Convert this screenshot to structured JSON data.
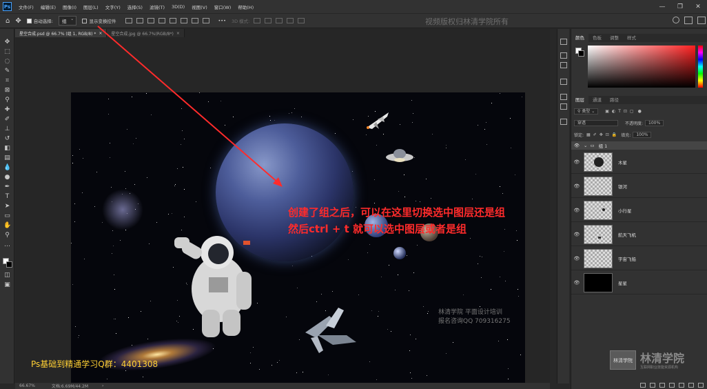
{
  "menubar": {
    "logo": "Ps",
    "items": [
      "文件(F)",
      "编辑(E)",
      "图像(I)",
      "图层(L)",
      "文字(Y)",
      "选择(S)",
      "滤镜(T)",
      "3D(D)",
      "视图(V)",
      "窗口(W)",
      "帮助(H)"
    ],
    "win_controls": [
      "—",
      "❐",
      "✕"
    ]
  },
  "options": {
    "auto_select_label": "自动选择:",
    "auto_select_value": "组",
    "show_transform_label": "显示变换控件",
    "mode_3d_label": "3D 模式:",
    "watermark": "视频版权归林清学院所有"
  },
  "tabs": [
    {
      "label": "星空合成.psd @ 66.7% (组 1, RGB/8) *"
    },
    {
      "label": "星空合成.jpg @ 66.7%(RGB/8*)"
    }
  ],
  "canvas": {
    "watermark_line1": "林清学院  平面设计培训",
    "watermark_line2": "报名咨询QQ 709316275"
  },
  "annotation": {
    "line1": "创建了组之后，可以在这里切换选中图层还是组",
    "line2": "然后ctrl + t 就可以选中图层或者是组",
    "color": "#ff2b2b"
  },
  "qq_group": "Ps基础到精通学习Q群：4401308",
  "status": {
    "zoom": "66.67%",
    "doc": "文档:6.69M/44.2M"
  },
  "color_panel": {
    "tabs": [
      "颜色",
      "色板",
      "调整",
      "样式"
    ]
  },
  "layers_panel": {
    "tabs": [
      "图层",
      "通道",
      "路径"
    ],
    "filter_kind": "类型",
    "blend_mode": "穿透",
    "opacity_label": "不透明度:",
    "opacity_value": "100%",
    "lock_label": "锁定:",
    "fill_label": "填充:",
    "fill_value": "100%",
    "group_name": "组 1",
    "layers": [
      {
        "name": "木星"
      },
      {
        "name": "银河"
      },
      {
        "name": "小行星"
      },
      {
        "name": "航天飞机"
      },
      {
        "name": "宇宙飞船"
      },
      {
        "name": "星星"
      }
    ]
  },
  "brand": {
    "logo_text": "林清学院",
    "name": "林清学院",
    "tagline": "互联网职业技能资源机构"
  }
}
